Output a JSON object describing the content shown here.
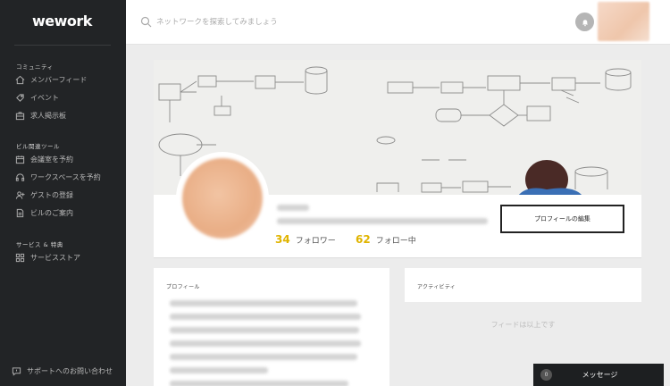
{
  "sidebar": {
    "logo": "wework",
    "sections": [
      {
        "label": "コミュニティ",
        "items": [
          {
            "label": "メンバーフィード",
            "icon": "home-icon"
          },
          {
            "label": "イベント",
            "icon": "ticket-icon"
          },
          {
            "label": "求人掲示板",
            "icon": "briefcase-icon"
          }
        ]
      },
      {
        "label": "ビル関連ツール",
        "items": [
          {
            "label": "会議室を予約",
            "icon": "calendar-icon"
          },
          {
            "label": "ワークスペースを予約",
            "icon": "headset-icon"
          },
          {
            "label": "ゲストの登録",
            "icon": "add-user-icon"
          },
          {
            "label": "ビルのご案内",
            "icon": "document-icon"
          }
        ]
      },
      {
        "label": "サービス & 特典",
        "items": [
          {
            "label": "サービスストア",
            "icon": "grid-icon"
          }
        ]
      }
    ],
    "support_label": "サポートへのお問い合わせ"
  },
  "topbar": {
    "search_placeholder": "ネットワークを探索してみましょう"
  },
  "profile": {
    "followers_count": "34",
    "followers_label": "フォロワー",
    "following_count": "62",
    "following_label": "フォロー中",
    "edit_button": "プロフィールの編集"
  },
  "cards": {
    "profile_title": "プロフィール",
    "activity_title": "アクティビティ",
    "feed_end": "フィードは以上です"
  },
  "messages": {
    "count": "0",
    "label": "メッセージ"
  },
  "colors": {
    "sidebar_bg": "#222426",
    "accent_count": "#e0b400",
    "page_bg": "#ececec"
  }
}
